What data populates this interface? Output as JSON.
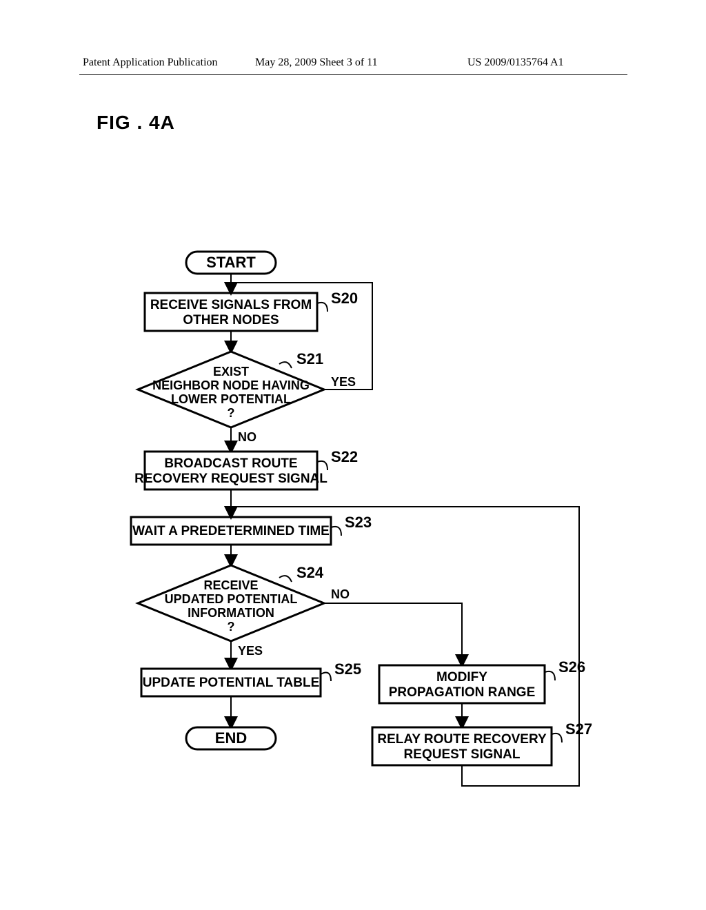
{
  "header": {
    "left": "Patent Application Publication",
    "mid": "May 28, 2009  Sheet 3 of 11",
    "right": "US 2009/0135764 A1"
  },
  "figure": {
    "label": "FIG . 4A"
  },
  "nodes": {
    "start": "START",
    "s20": "RECEIVE SIGNALS FROM\nOTHER NODES",
    "s21": "EXIST\nNEIGHBOR NODE HAVING\nLOWER POTENTIAL\n?",
    "s22": "BROADCAST ROUTE\nRECOVERY REQUEST SIGNAL",
    "s23": "WAIT A PREDETERMINED TIME",
    "s24": "RECEIVE\nUPDATED POTENTIAL\nINFORMATION\n?",
    "s25": "UPDATE POTENTIAL TABLE",
    "s26": "MODIFY\nPROPAGATION RANGE",
    "s27": "RELAY ROUTE RECOVERY\nREQUEST SIGNAL",
    "end": "END"
  },
  "labels": {
    "s20": "S20",
    "s21": "S21",
    "s22": "S22",
    "s23": "S23",
    "s24": "S24",
    "s25": "S25",
    "s26": "S26",
    "s27": "S27"
  },
  "branches": {
    "yes": "YES",
    "no": "NO"
  }
}
